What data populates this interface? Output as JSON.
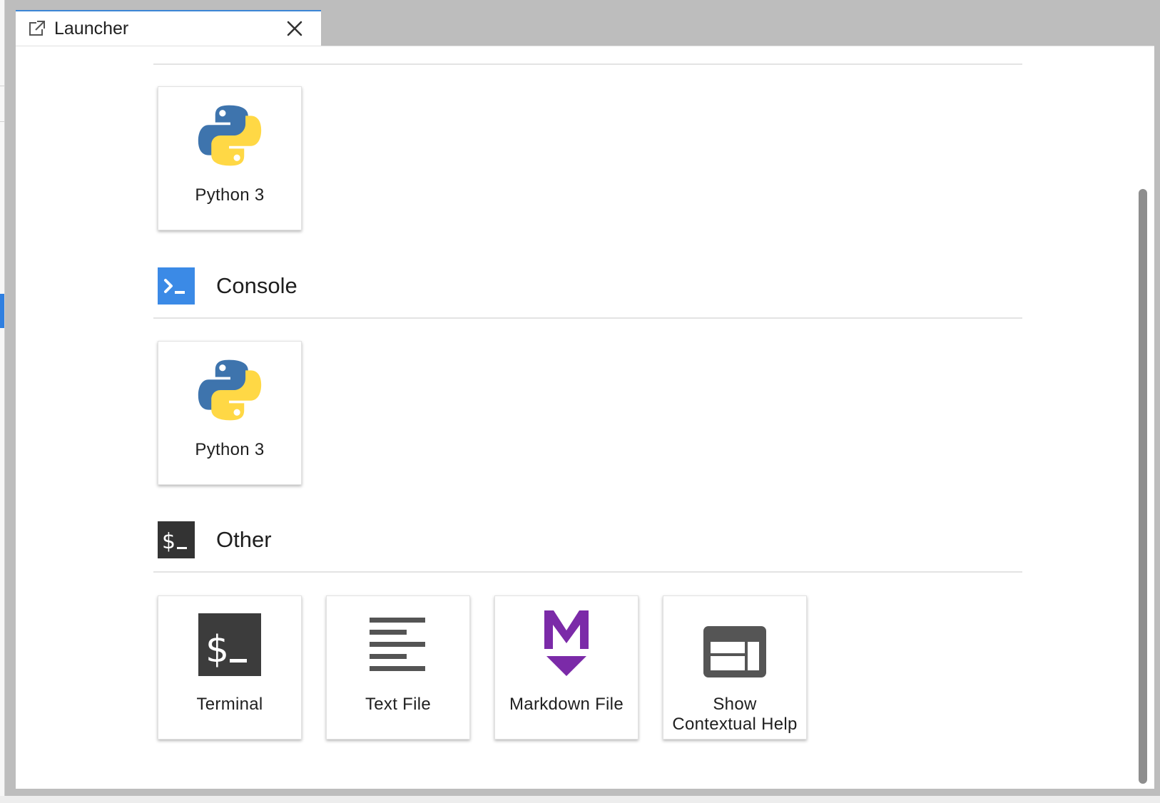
{
  "tab": {
    "title": "Launcher",
    "icon": "launch-icon",
    "close_icon": "close-icon"
  },
  "sections": {
    "notebook": {
      "cards": [
        {
          "label": "Python 3",
          "icon": "python-logo-icon"
        }
      ]
    },
    "console": {
      "title": "Console",
      "icon": "console-prompt-icon",
      "icon_color": "#3b8ae6",
      "cards": [
        {
          "label": "Python 3",
          "icon": "python-logo-icon"
        }
      ]
    },
    "other": {
      "title": "Other",
      "icon": "terminal-dollar-icon",
      "icon_color": "#333333",
      "cards": [
        {
          "label": "Terminal",
          "icon": "terminal-icon"
        },
        {
          "label": "Text File",
          "icon": "text-file-icon"
        },
        {
          "label": "Markdown File",
          "icon": "markdown-icon"
        },
        {
          "label": "Show Contextual Help",
          "icon": "contextual-help-icon"
        }
      ]
    }
  },
  "colors": {
    "python_blue": "#3e74ad",
    "python_yellow": "#ffd845",
    "markdown_purple": "#7b2aa8",
    "icon_dark": "#3c3c3c",
    "tab_accent": "#3b86d6"
  }
}
